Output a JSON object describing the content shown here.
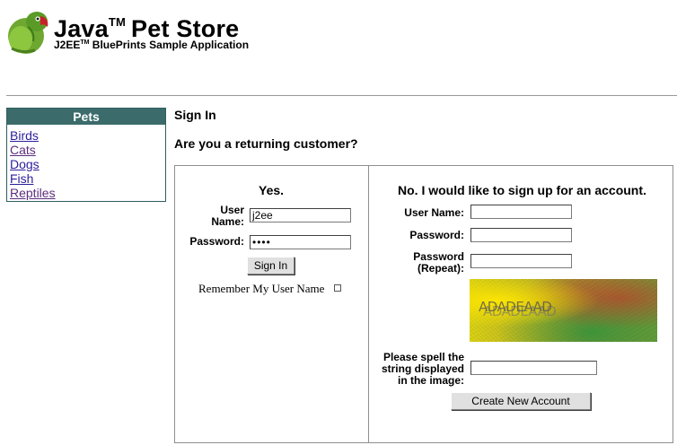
{
  "header": {
    "title": "Java",
    "title_tm": "TM",
    "title_rest": "Pet Store",
    "subtitle": "J2EE",
    "subtitle_tm": "TM",
    "subtitle_rest": " BluePrints Sample Application",
    "logo_icon": "parrot-logo-icon"
  },
  "sidebar": {
    "heading": "Pets",
    "items": [
      {
        "label": "Birds",
        "visited": false
      },
      {
        "label": "Cats",
        "visited": true
      },
      {
        "label": "Dogs",
        "visited": false
      },
      {
        "label": "Fish",
        "visited": false
      },
      {
        "label": "Reptiles",
        "visited": true
      }
    ]
  },
  "main": {
    "heading": "Sign In",
    "question": "Are you a returning customer?"
  },
  "signin": {
    "heading": "Yes.",
    "username_label_1": "User",
    "username_label_2": "Name:",
    "username_value": "j2ee",
    "password_label": "Password:",
    "password_value": "j2ee",
    "submit_label": "Sign In",
    "remember_label": "Remember My User Name",
    "remember_checked": false
  },
  "signup": {
    "heading": "No. I would like to sign up for an account.",
    "username_label": "User Name:",
    "username_value": "",
    "password_label": "Password:",
    "password_value": "",
    "password_repeat_label_1": "Password",
    "password_repeat_label_2": "(Repeat):",
    "password_repeat_value": "",
    "captcha_text": "ADADEAAD",
    "captcha_label_1": "Please spell the",
    "captcha_label_2": "string displayed",
    "captcha_label_3": "in the image:",
    "captcha_value": "",
    "submit_label": "Create New Account"
  },
  "colors": {
    "sidebar_header_bg": "#3b6b6b",
    "link": "#2a1e9b",
    "visited_link": "#5d2e7e"
  }
}
